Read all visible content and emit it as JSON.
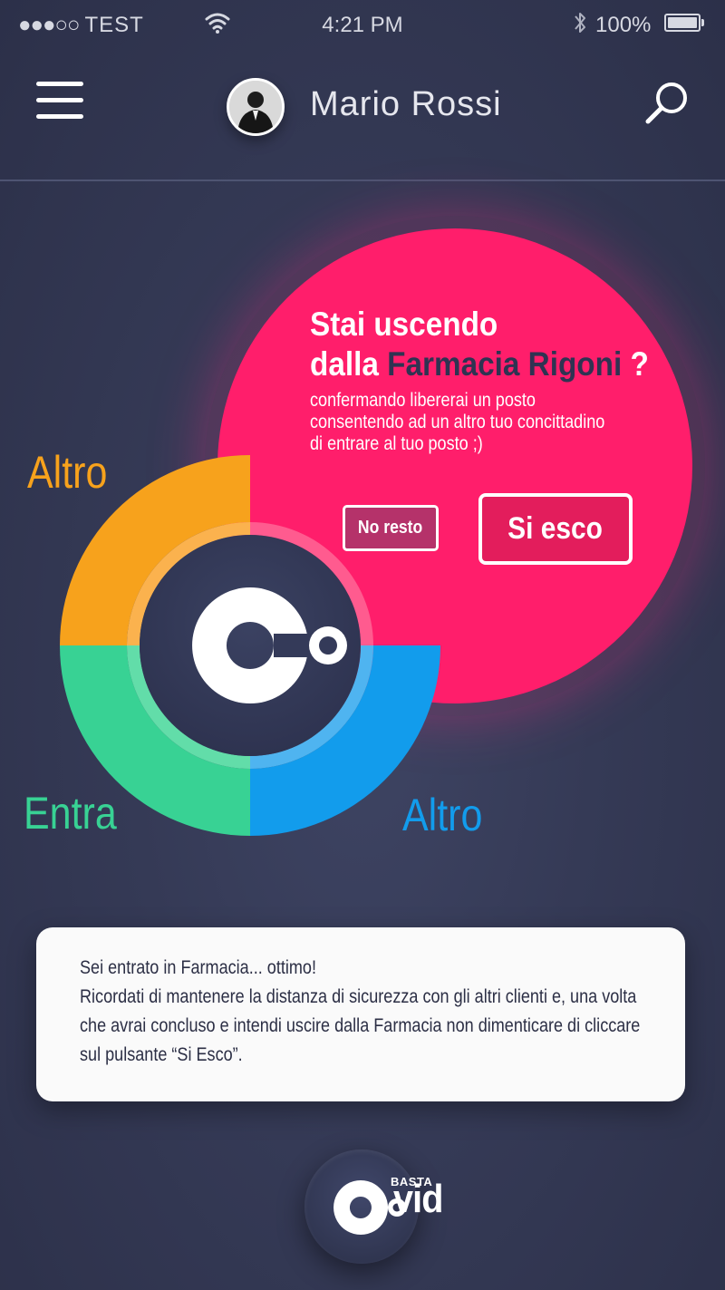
{
  "status_bar": {
    "carrier": "TEST",
    "signal_dots": "●●●○○",
    "time": "4:21 PM",
    "battery": "100%"
  },
  "header": {
    "user_name": "Mario Rossi"
  },
  "dialog": {
    "title_line1": "Stai uscendo",
    "title_line2_prefix": "dalla",
    "place": "Farmacia Rigoni",
    "title_suffix": "?",
    "message_lines": [
      "confermando libererai un posto",
      "consentendo ad un altro tuo concittadino",
      "di entrare al tuo posto ;)"
    ],
    "no_button": "No resto",
    "yes_button": "Si esco"
  },
  "wheel": {
    "top_left_label": "Altro",
    "bottom_left_label": "Entra",
    "bottom_right_label": "Altro",
    "colors": {
      "orange": "#f7a21c",
      "green": "#38d294",
      "blue": "#129cec",
      "pink": "#ff1e6b",
      "center": "#343a59"
    }
  },
  "info_card": {
    "lines": [
      "Sei entrato in Farmacia... ottimo!",
      "Ricordati di mantenere la distanza di sicurezza con gli altri clienti e, una volta",
      "che avrai concluso e intendi uscire dalla Farmacia non dimenticare di cliccare",
      "sul pulsante “Si Esco”."
    ]
  },
  "footer": {
    "logo_small": "BASTA",
    "logo_text": "vid"
  }
}
